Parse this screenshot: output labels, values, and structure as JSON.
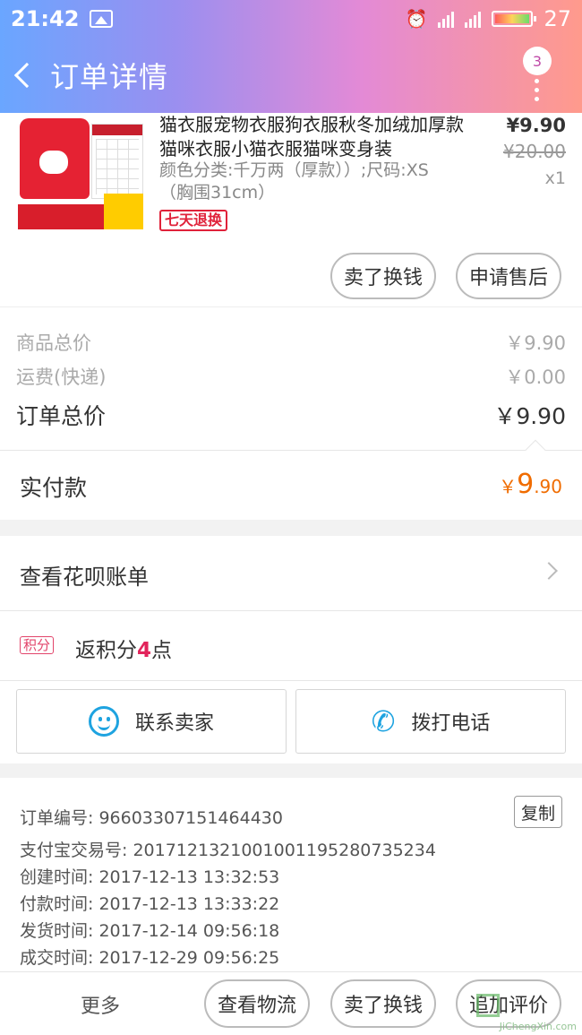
{
  "status_bar": {
    "time": "21:42",
    "battery": "27"
  },
  "header": {
    "title": "订单详情",
    "badge_count": "3"
  },
  "product": {
    "name": "猫衣服宠物衣服狗衣服秋冬加绒加厚款猫咪衣服小猫衣服猫咪变身装",
    "sku": "颜色分类:千万两（厚款））;尺码:XS（胸围31cm）",
    "return_tag": "七天退换",
    "price": "¥9.90",
    "original_price": "¥20.00",
    "quantity": "x1",
    "actions": {
      "sell": "卖了换钱",
      "after_sale": "申请售后"
    }
  },
  "totals": {
    "goods_label": "商品总价",
    "goods_value": "￥9.90",
    "shipping_label": "运费(快递)",
    "shipping_value": "￥0.00",
    "order_label": "订单总价",
    "order_value": "￥9.90"
  },
  "paid": {
    "label": "实付款",
    "currency": "￥",
    "int": "9",
    "dec": ".90",
    "color": "#f06c00"
  },
  "huabei": {
    "label": "查看花呗账单"
  },
  "points": {
    "tag": "积分",
    "prefix": "返积分",
    "value": "4",
    "suffix": "点"
  },
  "contact": {
    "seller": "联系卖家",
    "phone": "拨打电话"
  },
  "info": {
    "order_no_label": "订单编号:",
    "order_no": "96603307151464430",
    "copy": "复制",
    "alipay_label": "支付宝交易号:",
    "alipay_no": "2017121321001001195280735234",
    "created_label": "创建时间:",
    "created": "2017-12-13 13:32:53",
    "paid_label": "付款时间:",
    "paid_time": "2017-12-13 13:33:22",
    "shipped_label": "发货时间:",
    "shipped": "2017-12-14 09:56:18",
    "done_label": "成交时间:",
    "done": "2017-12-29 09:56:25"
  },
  "bottom_bar": {
    "more": "更多",
    "logistics": "查看物流",
    "sell": "卖了换钱",
    "review": "追加评价"
  },
  "watermark": "JiChengXin.com"
}
